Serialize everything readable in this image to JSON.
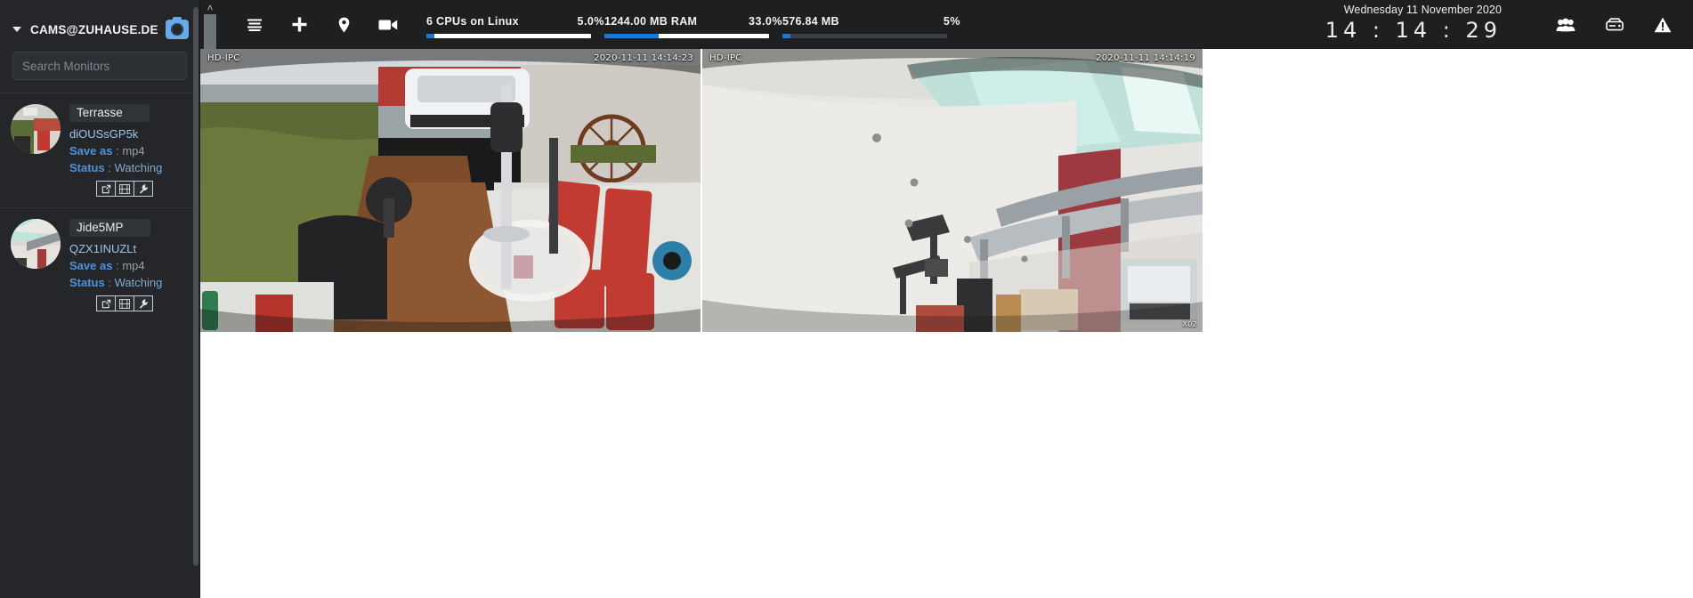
{
  "sidebar": {
    "account_name": "CAMS@ZUHAUSE.DE",
    "camera_badge_icon": "camera-icon",
    "collapse_icon": "caret-down-icon",
    "search": {
      "placeholder": "Search Monitors",
      "value": ""
    },
    "monitors": [
      {
        "title": "Terrasse",
        "id": "diOUSsGP5k",
        "save_as_key": "Save as",
        "save_as_sep": ":",
        "save_as_value": "mp4",
        "status_key": "Status",
        "status_sep": ":",
        "status_value": "Watching",
        "actions": [
          "open-in-new-window-icon",
          "film-strip-icon",
          "wrench-icon"
        ]
      },
      {
        "title": "Jide5MP",
        "id": "QZX1INUZLt",
        "save_as_key": "Save as",
        "save_as_sep": ":",
        "save_as_value": "mp4",
        "status_key": "Status",
        "status_sep": ":",
        "status_value": "Watching",
        "actions": [
          "open-in-new-window-icon",
          "film-strip-icon",
          "wrench-icon"
        ]
      }
    ]
  },
  "topbar": {
    "collapse_chevron": "˄",
    "icons": [
      "hamburger-menu-icon",
      "plus-icon",
      "map-pin-icon",
      "video-camera-icon"
    ],
    "stats": [
      {
        "label": "6 CPUs on Linux",
        "percent_text": "5.0%",
        "percent": 5,
        "bar_style": "light"
      },
      {
        "label": "1244.00 MB RAM",
        "percent_text": "33.0%",
        "percent": 33,
        "bar_style": "light"
      },
      {
        "label": "576.84 MB",
        "percent_text": "5%",
        "percent": 5,
        "bar_style": "dim"
      }
    ],
    "clock": {
      "date": "Wednesday 11 November 2020",
      "time": "14 : 14 : 29"
    },
    "right_icons": [
      "users-group-icon",
      "hard-drive-icon",
      "warning-triangle-icon"
    ],
    "accent_color": "#1878d4",
    "background_color": "#1d1f21"
  },
  "cameras": [
    {
      "name": "Terrasse",
      "osd_label": "HD-IPC",
      "osd_timestamp": "2020-11-11  14:14:23",
      "corner_label": ""
    },
    {
      "name": "Jide5MP",
      "osd_label": "HD-IPC",
      "osd_timestamp": "2020-11-11  14:14:19",
      "corner_label": "X02"
    }
  ]
}
